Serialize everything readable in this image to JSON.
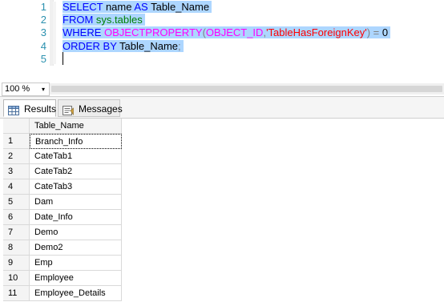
{
  "editor": {
    "line_numbers": [
      "1",
      "2",
      "3",
      "4",
      "5"
    ],
    "line1": {
      "kw_select": "SELECT",
      "name": " name ",
      "kw_as": "AS",
      "alias": " Table_Name"
    },
    "line2": {
      "kw_from": "FROM",
      "space": " ",
      "object": "sys.tables"
    },
    "line3": {
      "kw_where": "WHERE",
      "space": " ",
      "fn_objprop": "OBJECTPROPERTY",
      "paren_open": "(",
      "fn_objid": "OBJECT_ID",
      "comma": ",",
      "str_prop": "'TableHasForeignKey'",
      "paren_close": ")",
      "eq": " = ",
      "zero": "0"
    },
    "line4": {
      "kw_orderby": "ORDER BY",
      "col": " Table_Name",
      "semi": ";"
    }
  },
  "zoom": {
    "value": "100 %",
    "arrow": "▾"
  },
  "tabs": {
    "results_label": "Results",
    "messages_label": "Messages"
  },
  "grid": {
    "column_header": "Table_Name",
    "rows": [
      {
        "num": "1",
        "value": "Branch_Info"
      },
      {
        "num": "2",
        "value": "CateTab1"
      },
      {
        "num": "3",
        "value": "CateTab2"
      },
      {
        "num": "4",
        "value": "CateTab3"
      },
      {
        "num": "5",
        "value": "Dam"
      },
      {
        "num": "6",
        "value": "Date_Info"
      },
      {
        "num": "7",
        "value": "Demo"
      },
      {
        "num": "8",
        "value": "Demo2"
      },
      {
        "num": "9",
        "value": "Emp"
      },
      {
        "num": "10",
        "value": "Employee"
      },
      {
        "num": "11",
        "value": "Employee_Details"
      }
    ]
  },
  "colors": {
    "keyword": "#0000ff",
    "function": "#ff00ff",
    "system_object": "#008000",
    "string": "#ff0000",
    "operator": "#808080",
    "selection": "#add6ff",
    "line_number": "#2b91af"
  },
  "icons": {
    "results_tab": "grid-icon",
    "messages_tab": "messages-icon"
  }
}
